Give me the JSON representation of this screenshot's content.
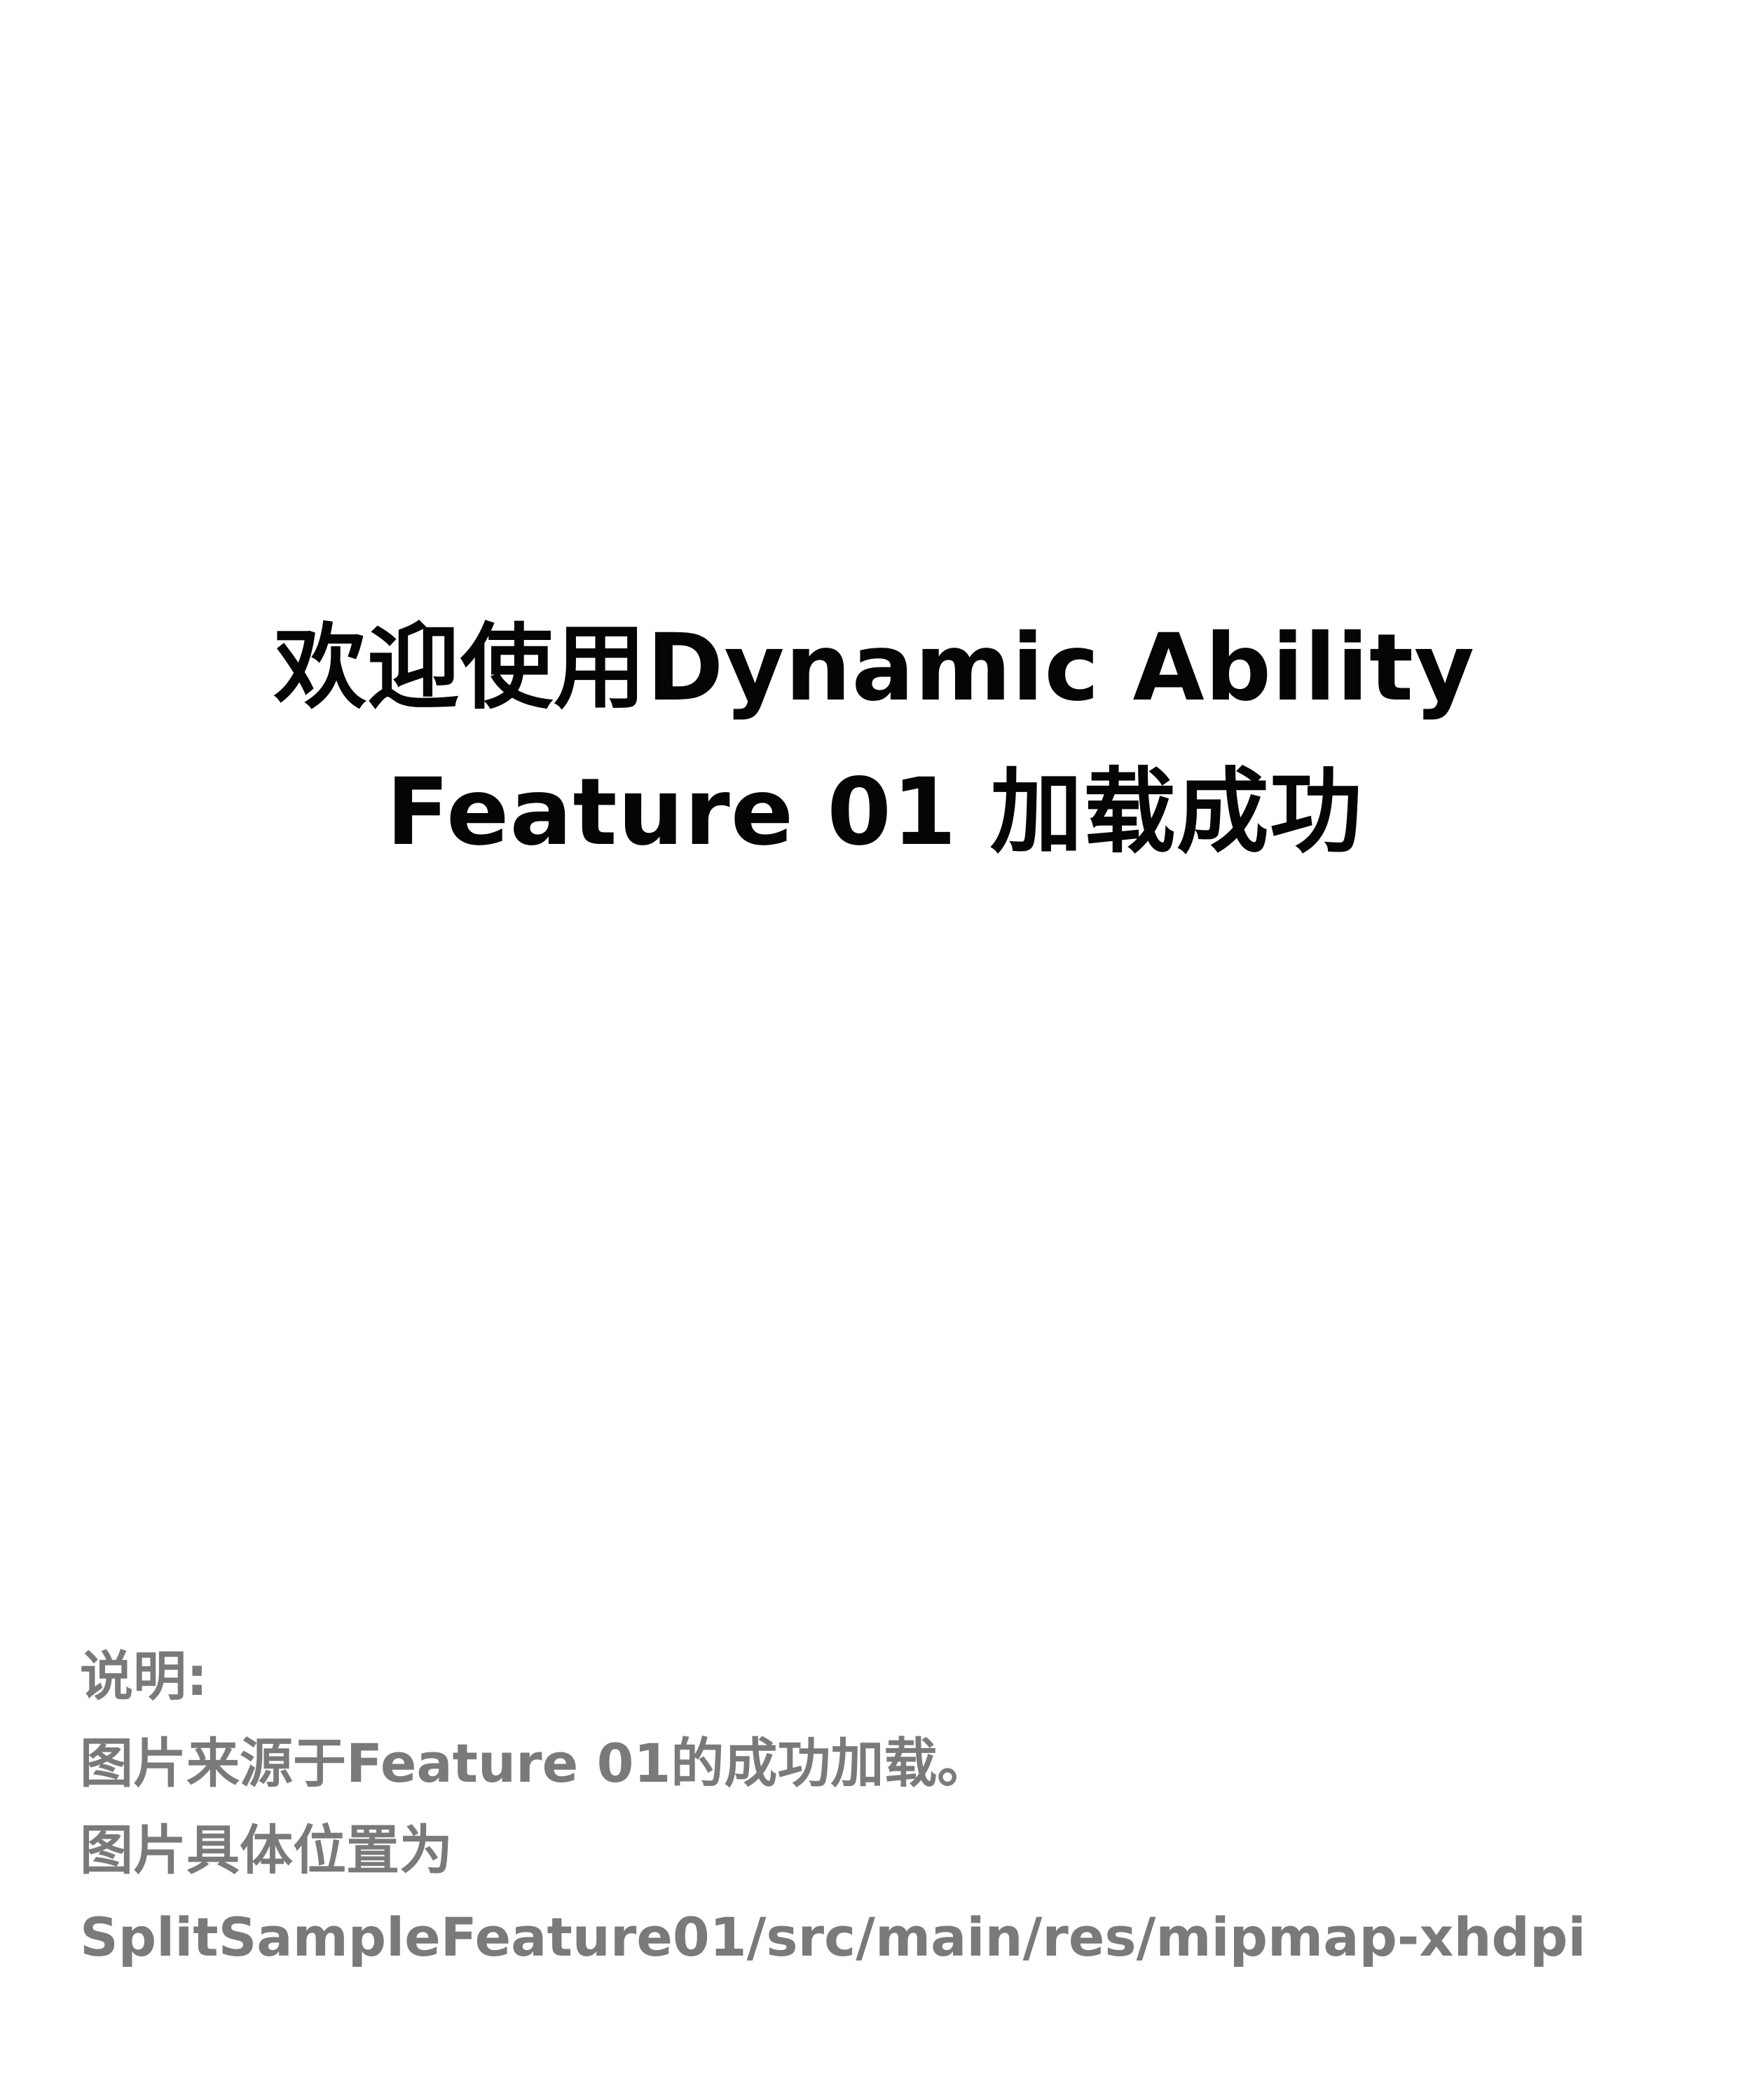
{
  "headline": {
    "line1": "欢迎使用Dynamic Ability",
    "line2": "Feature 01 加载成功"
  },
  "note": {
    "heading": "说明:",
    "line1": "图片来源于Feature 01的成功加载。",
    "line2": "图片具体位置为",
    "line3": "SplitSampleFeature01/src/main/res/mipmap-xhdpi"
  },
  "colors": {
    "background": "#ffffff",
    "headline": "#050505",
    "note": "#7a7a7a"
  }
}
